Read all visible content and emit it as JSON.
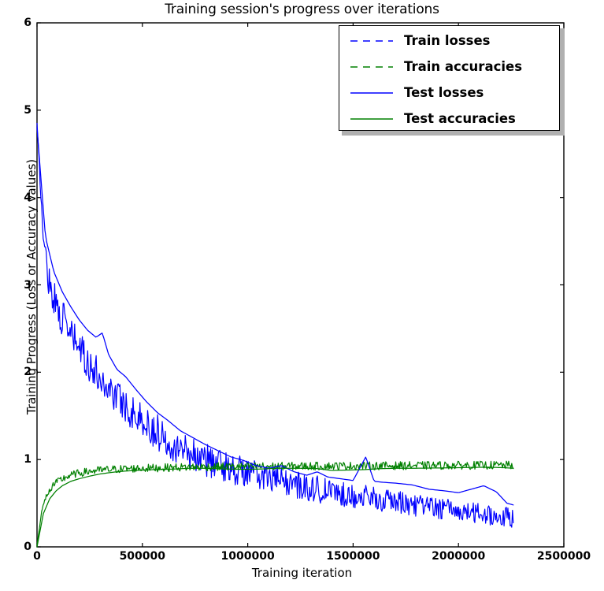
{
  "chart_data": {
    "type": "line",
    "title": "Training session's progress over iterations",
    "xlabel": "Training iteration",
    "ylabel": "Training Progress (Loss or Accuracy values)",
    "xlim": [
      0,
      2500000
    ],
    "ylim": [
      0,
      6
    ],
    "xticks": [
      0,
      500000,
      1000000,
      1500000,
      2000000,
      2500000
    ],
    "xtick_labels": [
      "0",
      "500000",
      "1000000",
      "1500000",
      "2000000",
      "2500000"
    ],
    "yticks": [
      0,
      1,
      2,
      3,
      4,
      5,
      6
    ],
    "ytick_labels": [
      "0",
      "1",
      "2",
      "3",
      "4",
      "5",
      "6"
    ],
    "grid": false,
    "legend_position": "upper right",
    "data_x_end": 2260000,
    "series": [
      {
        "name": "Train losses",
        "color": "#0000ff",
        "linestyle": "dashed",
        "noisy": true,
        "x": [
          0,
          30000,
          60000,
          90000,
          120000,
          150000,
          180000,
          210000,
          240000,
          270000,
          300000,
          340000,
          380000,
          420000,
          460000,
          500000,
          560000,
          620000,
          680000,
          740000,
          800000,
          870000,
          940000,
          1010000,
          1080000,
          1150000,
          1230000,
          1310000,
          1390000,
          1470000,
          1550000,
          1630000,
          1710000,
          1790000,
          1870000,
          1950000,
          2030000,
          2110000,
          2190000,
          2260000
        ],
        "y": [
          4.85,
          3.52,
          3.02,
          2.78,
          2.62,
          2.47,
          2.35,
          2.24,
          2.12,
          2.02,
          1.93,
          1.82,
          1.73,
          1.62,
          1.53,
          1.44,
          1.33,
          1.23,
          1.14,
          1.07,
          1.0,
          0.94,
          0.89,
          0.84,
          0.8,
          0.76,
          0.71,
          0.67,
          0.63,
          0.6,
          0.57,
          0.54,
          0.51,
          0.48,
          0.45,
          0.43,
          0.4,
          0.38,
          0.35,
          0.33
        ],
        "noise_amp": 0.16
      },
      {
        "name": "Train accuracies",
        "color": "#008000",
        "linestyle": "dashed",
        "noisy": true,
        "x": [
          0,
          25000,
          50000,
          75000,
          100000,
          130000,
          160000,
          200000,
          250000,
          300000,
          360000,
          430000,
          500000,
          580000,
          660000,
          750000,
          850000,
          960000,
          1080000,
          1200000,
          1330000,
          1460000,
          1600000,
          1740000,
          1880000,
          2020000,
          2150000,
          2260000
        ],
        "y": [
          0.02,
          0.45,
          0.62,
          0.7,
          0.75,
          0.79,
          0.82,
          0.845,
          0.865,
          0.878,
          0.888,
          0.895,
          0.9,
          0.905,
          0.91,
          0.915,
          0.918,
          0.92,
          0.922,
          0.924,
          0.925,
          0.927,
          0.928,
          0.93,
          0.932,
          0.934,
          0.935,
          0.935
        ],
        "noise_amp": 0.04
      },
      {
        "name": "Test losses",
        "color": "#0000ff",
        "linestyle": "solid",
        "noisy": false,
        "x": [
          0,
          40000,
          80000,
          120000,
          160000,
          200000,
          240000,
          280000,
          310000,
          340000,
          380000,
          420000,
          470000,
          520000,
          570000,
          620000,
          680000,
          740000,
          800000,
          860000,
          920000,
          980000,
          1040000,
          1100000,
          1160000,
          1220000,
          1280000,
          1330000,
          1380000,
          1440000,
          1500000,
          1560000,
          1600000,
          1640000,
          1700000,
          1780000,
          1860000,
          1940000,
          2000000,
          2060000,
          2120000,
          2180000,
          2230000,
          2260000
        ],
        "y": [
          4.8,
          3.55,
          3.15,
          2.92,
          2.75,
          2.6,
          2.48,
          2.4,
          2.45,
          2.2,
          2.03,
          1.95,
          1.8,
          1.66,
          1.54,
          1.45,
          1.33,
          1.25,
          1.17,
          1.1,
          1.03,
          0.99,
          0.93,
          0.9,
          0.93,
          0.86,
          0.82,
          0.86,
          0.8,
          0.78,
          0.76,
          1.03,
          0.75,
          0.74,
          0.73,
          0.71,
          0.66,
          0.64,
          0.62,
          0.66,
          0.7,
          0.63,
          0.5,
          0.48
        ]
      },
      {
        "name": "Test accuracies",
        "color": "#008000",
        "linestyle": "solid",
        "noisy": false,
        "x": [
          0,
          30000,
          60000,
          90000,
          120000,
          160000,
          200000,
          250000,
          300000,
          360000,
          420000,
          490000,
          560000,
          640000,
          720000,
          800000,
          880000,
          960000,
          1050000,
          1140000,
          1230000,
          1320000,
          1400000,
          1480000,
          1560000,
          1620000,
          1700000,
          1790000,
          1880000,
          1970000,
          2060000,
          2150000,
          2230000,
          2260000
        ],
        "y": [
          0.0,
          0.38,
          0.55,
          0.64,
          0.7,
          0.75,
          0.78,
          0.81,
          0.835,
          0.855,
          0.868,
          0.878,
          0.885,
          0.89,
          0.9,
          0.9,
          0.893,
          0.888,
          0.89,
          0.9,
          0.9,
          0.898,
          0.875,
          0.88,
          0.885,
          0.895,
          0.9,
          0.9,
          0.903,
          0.905,
          0.91,
          0.912,
          0.905,
          0.9
        ]
      }
    ]
  },
  "legend": {
    "entries": [
      {
        "label": "Train losses"
      },
      {
        "label": "Train accuracies"
      },
      {
        "label": "Test losses"
      },
      {
        "label": "Test accuracies"
      }
    ]
  }
}
